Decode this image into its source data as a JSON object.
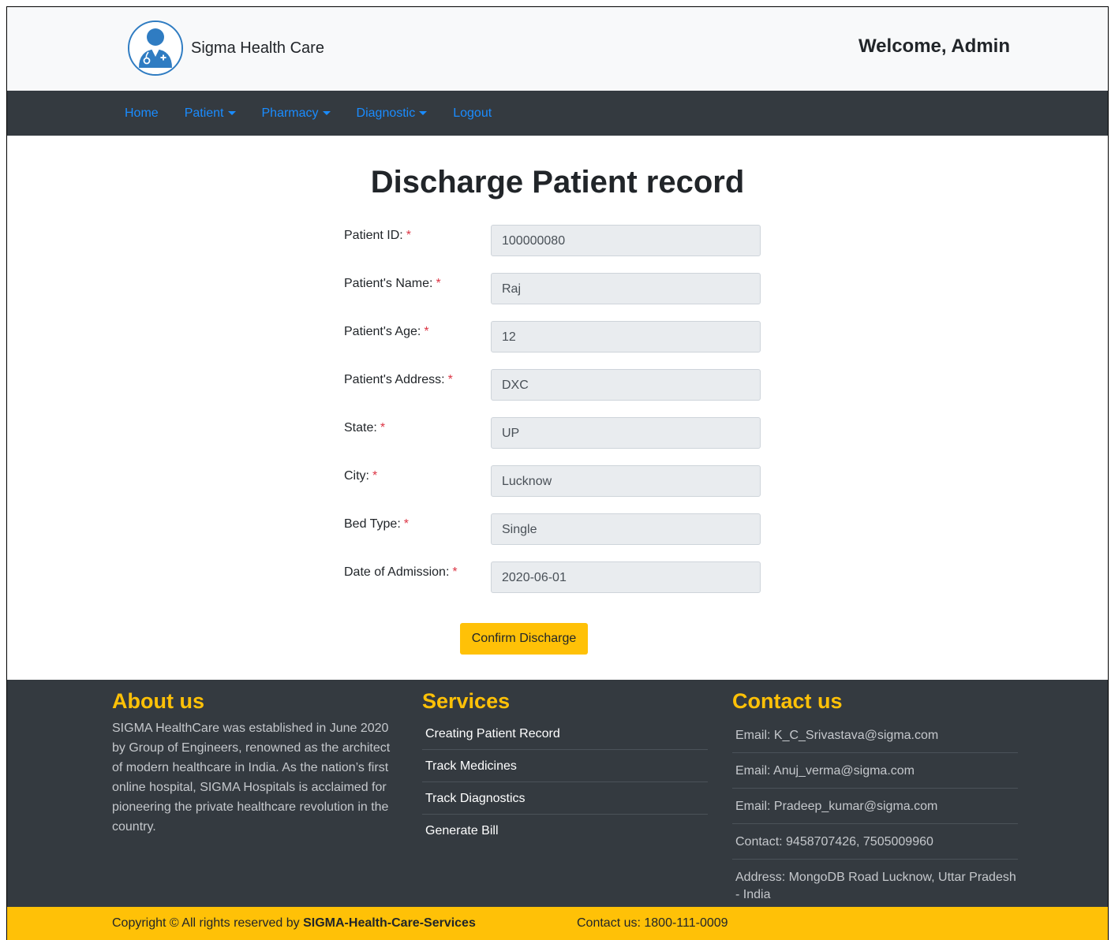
{
  "header": {
    "brand": "Sigma Health Care",
    "welcome": "Welcome, Admin"
  },
  "nav": {
    "home": "Home",
    "patient": "Patient",
    "pharmacy": "Pharmacy",
    "diagnostic": "Diagnostic",
    "logout": "Logout"
  },
  "page": {
    "title": "Discharge Patient record"
  },
  "form": {
    "fields": [
      {
        "label": "Patient ID:",
        "value": "100000080"
      },
      {
        "label": "Patient's Name:",
        "value": "Raj"
      },
      {
        "label": "Patient's Age:",
        "value": "12"
      },
      {
        "label": "Patient's Address:",
        "value": "DXC"
      },
      {
        "label": "State:",
        "value": "UP"
      },
      {
        "label": "City:",
        "value": "Lucknow"
      },
      {
        "label": "Bed Type:",
        "value": "Single"
      },
      {
        "label": "Date of Admission:",
        "value": "2020-06-01"
      }
    ],
    "required_mark": "*",
    "submit_label": "Confirm Discharge"
  },
  "footer": {
    "about": {
      "title": "About us",
      "text": "SIGMA HealthCare was established in June 2020 by Group of Engineers, renowned as the architect of modern healthcare in India. As the nation’s first online hospital, SIGMA Hospitals is acclaimed for pioneering the private healthcare revolution in the country."
    },
    "services": {
      "title": "Services",
      "items": [
        "Creating Patient Record",
        "Track Medicines",
        "Track Diagnostics",
        "Generate Bill"
      ]
    },
    "contact": {
      "title": "Contact us",
      "items": [
        "Email: K_C_Srivastava@sigma.com",
        "Email: Anuj_verma@sigma.com",
        "Email: Pradeep_kumar@sigma.com",
        "Contact: 9458707426, 7505009960",
        "Address: MongoDB Road Lucknow, Uttar Pradesh - India"
      ]
    }
  },
  "copyright": {
    "prefix": "Copyright © All rights reserved by ",
    "company": "SIGMA-Health-Care-Services",
    "contact": "Contact us: 1800-111-0009"
  },
  "colors": {
    "accent": "#ffc107",
    "nav_link": "#1a8cff",
    "dark": "#343a40",
    "required": "#dc3545"
  },
  "icons": {
    "logo": "doctor-avatar-icon",
    "dropdown": "caret-down-icon"
  }
}
